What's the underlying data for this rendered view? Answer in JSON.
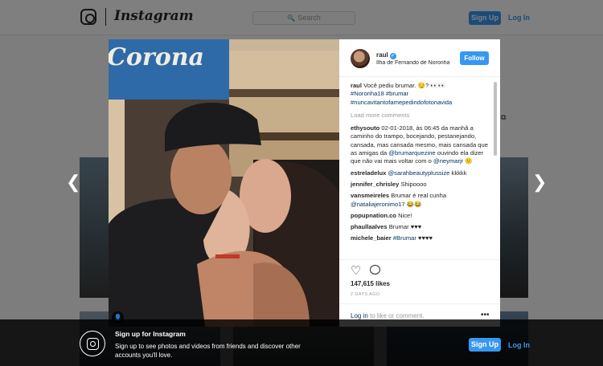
{
  "topbar": {
    "brand": "Instagram",
    "search_placeholder": "Search",
    "signup_label": "Sign Up",
    "login_label": "Log In"
  },
  "nav": {
    "prev_icon": "chevron-left-icon",
    "next_icon": "chevron-right-icon"
  },
  "photo": {
    "sign_text": "Corona"
  },
  "post": {
    "username": "raul",
    "verified": true,
    "location": "Ilha de Fernando de Noronha",
    "follow_label": "Follow",
    "caption": {
      "user": "raul",
      "text": "Você pediu brumar. 😏? 👀👀",
      "tags": "#Noronha18 #brumar #nuncavitantofamepedindofotonavida"
    },
    "load_more": "Load more comments",
    "comments": [
      {
        "user": "ethysouto",
        "pre": "02-01-2018, às 06:45 da manhã a caminho do trampo, bocejando, pestanejando, cansada, mas cansada mesmo, mais cansada que as amigas da ",
        "mention": "@brumarquezine",
        "post": " ouvindo ela dizer que não vai mais voltar com o ",
        "mention2": "@neymarjr",
        "post2": " 😕"
      },
      {
        "user": "estreladelux",
        "pre": "",
        "mention": "@sarahbeautyplussize",
        "post": " kkkkk"
      },
      {
        "user": "jennifer_chrisley",
        "pre": "Shipoooo",
        "mention": "",
        "post": ""
      },
      {
        "user": "vansmeireles",
        "pre": "Brumar é real cunha ",
        "mention": "@nataliajeronimo17",
        "post": " 😂😂"
      },
      {
        "user": "popupnation.co",
        "pre": "Nice!",
        "mention": "",
        "post": ""
      },
      {
        "user": "phaullaalves",
        "pre": "Brumar ♥♥♥",
        "mention": "",
        "post": ""
      },
      {
        "user": "michele_baier",
        "pre": "",
        "mention": "#Brumar",
        "post": " ♥♥♥♥"
      }
    ],
    "likes": "147,615 likes",
    "time_ago": "2 DAYS AGO",
    "login_link": "Log in",
    "login_suffix": " to like or comment.",
    "more_label": "•••"
  },
  "banner": {
    "title": "Sign up for Instagram",
    "description": "Sign up to see photos and videos from friends and discover other accounts you'll love.",
    "signup_label": "Sign Up",
    "login_label": "Log In"
  },
  "colors": {
    "accent": "#3897f0",
    "link": "#003569"
  }
}
